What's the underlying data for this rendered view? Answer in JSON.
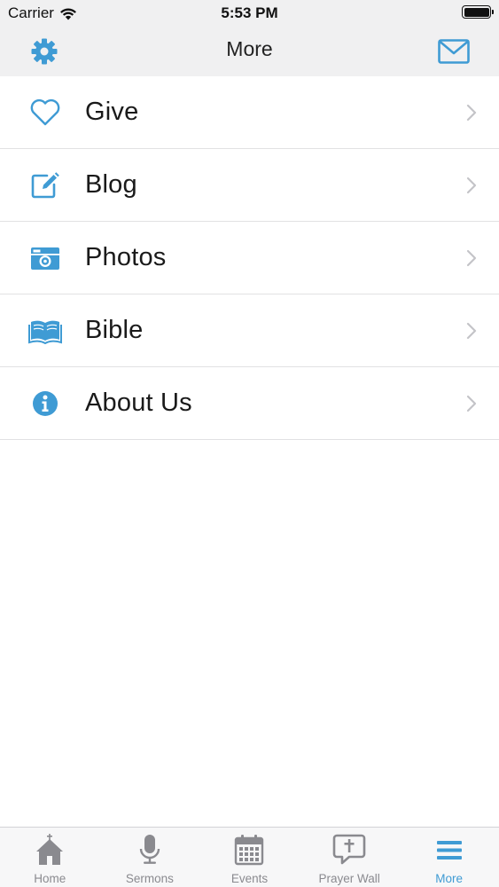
{
  "status_bar": {
    "carrier": "Carrier",
    "time": "5:53 PM",
    "battery_level": 1.0
  },
  "nav": {
    "title": "More",
    "left_icon": "gear-icon",
    "right_icon": "envelope-icon"
  },
  "menu": {
    "items": [
      {
        "label": "Give",
        "icon": "heart-icon"
      },
      {
        "label": "Blog",
        "icon": "edit-icon"
      },
      {
        "label": "Photos",
        "icon": "camera-icon"
      },
      {
        "label": "Bible",
        "icon": "book-icon"
      },
      {
        "label": "About Us",
        "icon": "info-icon"
      }
    ]
  },
  "tabs": {
    "items": [
      {
        "label": "Home",
        "icon": "church-icon"
      },
      {
        "label": "Sermons",
        "icon": "microphone-icon"
      },
      {
        "label": "Events",
        "icon": "calendar-icon"
      },
      {
        "label": "Prayer Wall",
        "icon": "prayer-bubble-icon"
      },
      {
        "label": "More",
        "icon": "menu-icon"
      }
    ],
    "active_index": 4
  },
  "colors": {
    "accent": "#3f9bd4",
    "inactive": "#8a8a8f",
    "bar_background": "#f0f0f1",
    "separator": "#e1e1e3"
  }
}
